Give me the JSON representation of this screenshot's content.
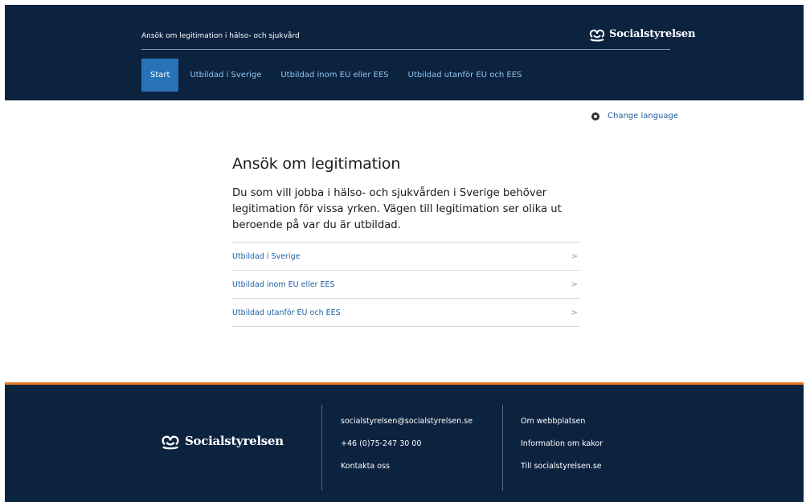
{
  "header": {
    "site_title": "Ansök om legitimation i hälso- och sjukvård",
    "logo_text": "Socialstyrelsen"
  },
  "nav": {
    "items": [
      {
        "label": "Start",
        "active": true
      },
      {
        "label": "Utbildad i Sverige",
        "active": false
      },
      {
        "label": "Utbildad inom EU eller EES",
        "active": false
      },
      {
        "label": "Utbildad utanför EU och EES",
        "active": false
      }
    ]
  },
  "language": {
    "label": "Change language",
    "icon": "globe-icon"
  },
  "main": {
    "title": "Ansök om legitimation",
    "intro": "Du som vill jobba i hälso- och sjukvården i Sverige behöver legitimation för vissa yrken. Vägen till legitimation ser olika ut beroende på var du är utbildad.",
    "links": [
      {
        "label": "Utbildad i Sverige",
        "chevron": ">"
      },
      {
        "label": "Utbildad inom EU eller EES",
        "chevron": ">"
      },
      {
        "label": "Utbildad utanför EU och EES",
        "chevron": ">"
      }
    ]
  },
  "footer": {
    "logo_text": "Socialstyrelsen",
    "contact": [
      "socialstyrelsen@socialstyrelsen.se",
      "+46 (0)75-247 30 00",
      "Kontakta oss"
    ],
    "links": [
      "Om webbplatsen",
      "Information om kakor",
      "Till socialstyrelsen.se"
    ]
  },
  "colors": {
    "navy": "#0c2340",
    "nav_active": "#2873b8",
    "link": "#1f5f9f",
    "accent_orange": "#e87722"
  }
}
